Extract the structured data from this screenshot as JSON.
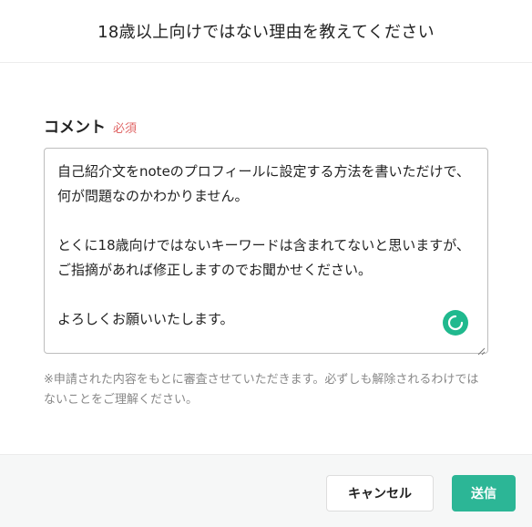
{
  "dialog": {
    "title": "18歳以上向けではない理由を教えてください"
  },
  "form": {
    "label": "コメント",
    "required_label": "必須",
    "comment_value": "自己紹介文をnoteのプロフィールに設定する方法を書いただけで、何が問題なのかわかりません。\n\nとくに18歳向けではないキーワードは含まれてないと思いますが、ご指摘があれば修正しますのでお聞かせください。\n\nよろしくお願いいたします。",
    "note": "※申請された内容をもとに審査させていただきます。必ずしも解除されるわけではないことをご理解ください。"
  },
  "footer": {
    "cancel_label": "キャンセル",
    "submit_label": "送信"
  },
  "colors": {
    "accent": "#2cb696",
    "required": "#e06666"
  },
  "icons": {
    "spinner": "loading-spinner-icon",
    "resize": "resize-handle-icon"
  }
}
